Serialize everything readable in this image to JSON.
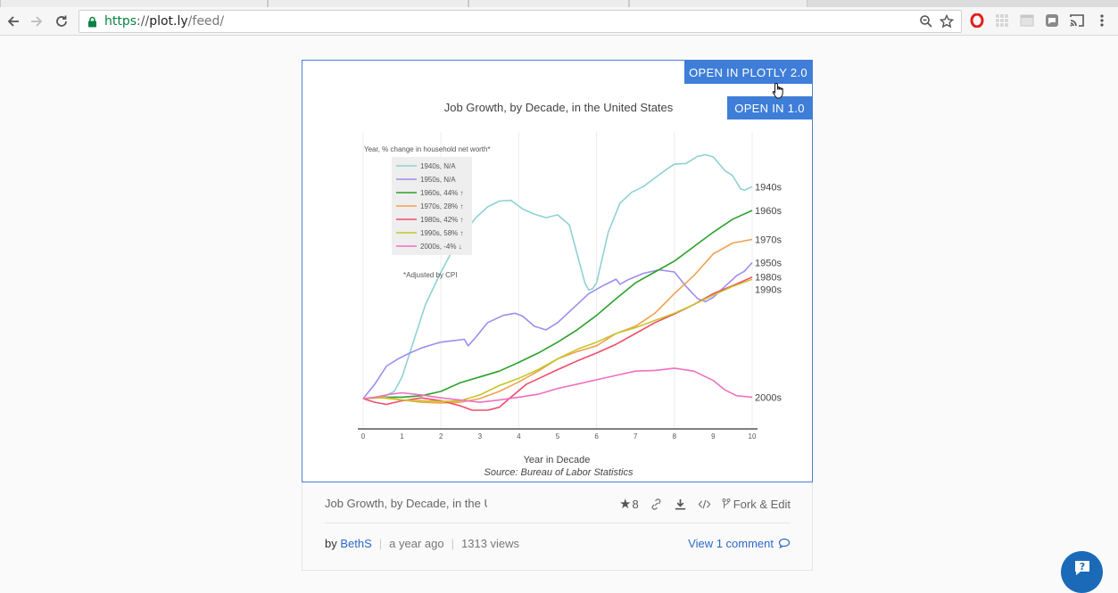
{
  "browser": {
    "url_scheme": "https",
    "url_sep": "://",
    "url_host": "plot.ly",
    "url_path": "/feed/"
  },
  "card": {
    "open_v2_label": "OPEN IN PLOTLY 2.0",
    "open_v1_label": "OPEN IN 1.0",
    "title_short": "Job Growth, by Decade, in the U",
    "stars": "8",
    "fork_label": "Fork & Edit",
    "by_label": "by",
    "author": "BethS",
    "age": "a year ago",
    "views": "1313 views",
    "comment_label": "View 1 comment"
  },
  "chart_data": {
    "type": "line",
    "title": "Job Growth, by Decade, in the United States",
    "xlabel": "Year in Decade",
    "source": "Source: Bureau of Labor Statistics",
    "xlim": [
      0,
      10
    ],
    "x_ticks": [
      "0",
      "1",
      "2",
      "3",
      "4",
      "5",
      "6",
      "7",
      "8",
      "9",
      "10"
    ],
    "legend_title": "Year, % change in household net worth*",
    "legend_note": "*Adjusted by CPI",
    "series": [
      {
        "name": "1940s, N/A",
        "end_label": "1940s",
        "color": "#8fd1d4",
        "x": [
          0,
          0.5,
          0.8,
          1,
          1.3,
          1.6,
          2,
          2.3,
          2.6,
          2.9,
          3.2,
          3.5,
          3.8,
          4.1,
          4.4,
          4.7,
          5,
          5.3,
          5.5,
          5.7,
          5.8,
          5.9,
          6,
          6.3,
          6.6,
          6.9,
          7.2,
          7.5,
          7.8,
          8,
          8.3,
          8.6,
          8.8,
          9,
          9.3,
          9.5,
          9.7,
          9.8,
          10
        ],
        "y": [
          0,
          0.2,
          1,
          3,
          8,
          13,
          17.5,
          20.5,
          23,
          25,
          26.5,
          27.3,
          27.4,
          26.2,
          25.5,
          25,
          25.4,
          24,
          20,
          16,
          15,
          15.2,
          16,
          23,
          27,
          28.5,
          29.3,
          30.5,
          31.7,
          32.4,
          32.5,
          33.5,
          33.7,
          33.4,
          31.5,
          30.8,
          29,
          28.8,
          29.3
        ]
      },
      {
        "name": "1950s, N/A",
        "end_label": "1950s",
        "color": "#9b8ef0",
        "x": [
          0,
          0.3,
          0.6,
          0.9,
          1.2,
          1.5,
          1.8,
          2,
          2.3,
          2.6,
          2.7,
          2.9,
          3.2,
          3.6,
          3.9,
          4.1,
          4.4,
          4.7,
          5,
          5.4,
          5.8,
          6.2,
          6.5,
          6.6,
          6.8,
          7.2,
          7.6,
          8,
          8.3,
          8.6,
          8.8,
          9,
          9.3,
          9.6,
          9.8,
          10
        ],
        "y": [
          0,
          2,
          4.5,
          5.5,
          6.3,
          7,
          7.5,
          7.8,
          8,
          8.2,
          7.3,
          8.5,
          10.5,
          11.5,
          11.8,
          11.4,
          10,
          9.5,
          10.5,
          12.5,
          14.5,
          15.7,
          16.5,
          15.8,
          16.4,
          17.3,
          17.8,
          17.5,
          15.5,
          13.8,
          13.4,
          14,
          15.5,
          17,
          17.6,
          18.8
        ]
      },
      {
        "name": "1960s, 44% ↑",
        "end_label": "1960s",
        "color": "#2ca02c",
        "x": [
          0,
          0.5,
          1,
          1.5,
          2,
          2.5,
          3,
          3.5,
          4,
          4.5,
          5,
          5.5,
          6,
          6.5,
          7,
          7.5,
          8,
          8.5,
          9,
          9.5,
          10
        ],
        "y": [
          0,
          0.2,
          0.2,
          0.4,
          1,
          2.2,
          3,
          3.8,
          5,
          6.3,
          7.8,
          9.5,
          11.5,
          13.8,
          16,
          17.5,
          19,
          21,
          23,
          24.8,
          26
        ]
      },
      {
        "name": "1970s, 28% ↑",
        "end_label": "1970s",
        "color": "#f0a14f",
        "x": [
          0,
          0.5,
          1,
          1.5,
          2,
          2.5,
          3,
          3.5,
          4,
          4.5,
          5,
          5.5,
          6,
          6.5,
          7,
          7.5,
          8,
          8.5,
          9,
          9.5,
          10
        ],
        "y": [
          0,
          0.2,
          -0.2,
          -0.5,
          -0.6,
          -0.5,
          0,
          1,
          2.3,
          3.8,
          5.5,
          6.5,
          7.3,
          9,
          10,
          11.8,
          14.5,
          17,
          20,
          21.5,
          22
        ]
      },
      {
        "name": "1980s, 42% ↑",
        "end_label": "1980s",
        "color": "#f24b6a",
        "x": [
          0,
          0.3,
          0.6,
          1,
          1.5,
          2,
          2.5,
          2.8,
          3.2,
          3.5,
          3.8,
          4.2,
          4.6,
          5,
          5.5,
          6,
          6.5,
          7,
          7.5,
          8,
          8.5,
          9,
          9.5,
          10
        ],
        "y": [
          0,
          -0.5,
          -0.8,
          -0.3,
          0.1,
          -0.3,
          -1,
          -1.6,
          -1.6,
          -1.2,
          0.2,
          2,
          3,
          4,
          5.2,
          6.3,
          7.5,
          9,
          10.5,
          11.7,
          13,
          14.5,
          15.6,
          16.8
        ]
      },
      {
        "name": "1990s, 58% ↑",
        "end_label": "1990s",
        "color": "#c7c42a",
        "x": [
          0,
          0.5,
          1,
          1.5,
          2,
          2.5,
          3,
          3.5,
          4,
          4.5,
          5,
          5.5,
          6,
          6.5,
          7,
          7.5,
          8,
          8.5,
          9,
          9.5,
          10
        ],
        "y": [
          0,
          0.1,
          -0.2,
          -0.3,
          -0.4,
          -0.3,
          0.5,
          1.8,
          2.8,
          4,
          5.5,
          6.8,
          7.8,
          9,
          9.8,
          10.8,
          11.8,
          13,
          14.3,
          15.5,
          16.5
        ]
      },
      {
        "name": "2000s, -4% ↓",
        "end_label": "2000s",
        "color": "#f06fc0",
        "x": [
          0,
          0.3,
          0.7,
          1,
          1.5,
          2,
          2.5,
          3,
          3.5,
          4,
          4.5,
          5,
          5.5,
          6,
          6.5,
          7,
          7.5,
          8,
          8.5,
          9,
          9.3,
          9.6,
          10
        ],
        "y": [
          0,
          0.2,
          0.6,
          0.8,
          0.5,
          0.1,
          -0.2,
          -0.5,
          -0.2,
          0.2,
          0.6,
          1.4,
          2,
          2.6,
          3.2,
          3.8,
          3.9,
          4.2,
          3.8,
          2.5,
          1.2,
          0.4,
          0.2
        ]
      }
    ]
  }
}
